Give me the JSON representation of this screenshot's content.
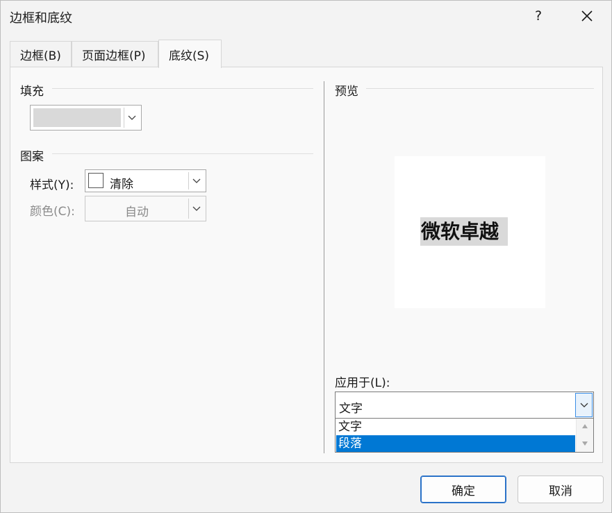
{
  "dialog": {
    "title": "边框和底纹",
    "help": "?",
    "close_icon": "close-icon"
  },
  "tabs": [
    {
      "label": "边框(B)",
      "active": false
    },
    {
      "label": "页面边框(P)",
      "active": false
    },
    {
      "label": "底纹(S)",
      "active": true
    }
  ],
  "fill": {
    "group_label": "填充",
    "swatch_color": "#d9d9d9"
  },
  "pattern": {
    "group_label": "图案",
    "style_label": "样式(Y):",
    "style_value": "清除",
    "color_label": "颜色(C):",
    "color_value": "自动"
  },
  "preview": {
    "group_label": "预览",
    "sample_text": "微软卓越"
  },
  "apply_to": {
    "label": "应用于(L):",
    "selected": "文字",
    "options": [
      "文字",
      "段落"
    ],
    "highlighted_index": 1
  },
  "buttons": {
    "ok": "确定",
    "cancel": "取消"
  },
  "colors": {
    "accent": "#0078d4",
    "highlight": "#0078d4",
    "shading": "#d9d9d9"
  }
}
